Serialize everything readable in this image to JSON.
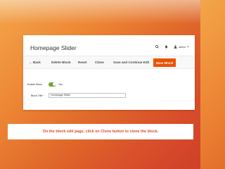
{
  "app": {
    "page_title": "Homepage Slider",
    "user_name": "admin",
    "header_icons": [
      "search-icon",
      "bell-icon",
      "user-icon",
      "chevron-down-icon"
    ]
  },
  "toolbar": {
    "back_label": "← Back",
    "delete_label": "Delete Block",
    "reset_label": "Reset",
    "clone_label": "Clone",
    "save_continue_label": "Save and Continue Edit",
    "save_label": "Save Block"
  },
  "form": {
    "enable_label": "Enable Block",
    "enable_value": "Yes",
    "title_label": "Block Title",
    "title_required_mark": "*",
    "title_value": "Homepage Slider"
  },
  "caption": {
    "text": "On the block edit page, click on Clone button to clone the block."
  },
  "colors": {
    "primary_button": "#eb5202",
    "toggle_on": "#79a22e",
    "caption_text": "#e04a2a"
  }
}
